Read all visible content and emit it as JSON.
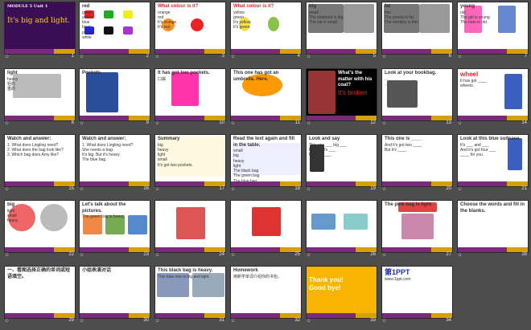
{
  "colors": {
    "background": "#4d4d4d",
    "band_default": "#7a2a7a",
    "band_accent": "#d6a000",
    "red_text": "#d11",
    "blue_text": "#1d2fb0"
  },
  "slides": [
    {
      "num": "1",
      "lines": [
        "MODULE 5  Unit 1",
        "It's big and light."
      ],
      "theme": "purple"
    },
    {
      "num": "2",
      "lines": [
        "red",
        "green",
        "yellow",
        "blue",
        "black",
        "purple",
        "white"
      ],
      "theme": "colors"
    },
    {
      "num": "3",
      "lines": [
        "What colour is it?",
        "orange",
        "red",
        "It's orange.",
        "It's red."
      ],
      "theme": "fruit"
    },
    {
      "num": "4",
      "lines": [
        "What colour is it?",
        "yellow",
        "green",
        "It's yellow.",
        "It's green."
      ],
      "theme": "fruit2"
    },
    {
      "num": "5",
      "lines": [
        "big",
        "small",
        "The elephant is big.",
        "The cat is small."
      ],
      "theme": "photo"
    },
    {
      "num": "6",
      "lines": [
        "fat",
        "thin",
        "The panda is fat.",
        "The monkey is thin."
      ],
      "theme": "photo"
    },
    {
      "num": "7",
      "lines": [
        "young",
        "old",
        "The girl is young.",
        "The man is old."
      ],
      "theme": "cartoon"
    },
    {
      "num": "8",
      "lines": [
        "light",
        "heavy",
        "轻的",
        "重的"
      ],
      "theme": "scale"
    },
    {
      "num": "9",
      "lines": [
        "Pockets"
      ],
      "theme": "coat"
    },
    {
      "num": "10",
      "lines": [
        "It has got two pockets.",
        "口袋"
      ],
      "theme": "bag"
    },
    {
      "num": "11",
      "lines": [
        "This one has got an umbrella. Here."
      ],
      "theme": "umbrella"
    },
    {
      "num": "12",
      "lines": [
        "What's the matter with his coat?",
        "It's broken"
      ],
      "theme": "broken"
    },
    {
      "num": "13",
      "lines": [
        "Look at your bookbag.",
        "...",
        "..."
      ],
      "theme": "bookbag"
    },
    {
      "num": "14",
      "lines": [
        "wheel",
        "It has got ____",
        "wheels."
      ],
      "theme": "wheel"
    },
    {
      "num": "15",
      "lines": [
        "Watch and answer:",
        "1. What does Lingling need?",
        "2. What does the bag look like?",
        "3. Which bag does Amy like?"
      ],
      "theme": "text"
    },
    {
      "num": "16",
      "lines": [
        "Watch and answer:",
        "1. What does Lingling need?",
        "She needs a bag.",
        "It's big. But it's heavy.",
        "The blue bag."
      ],
      "theme": "text"
    },
    {
      "num": "17",
      "lines": [
        "Summary",
        "big",
        "heavy",
        "light",
        "small",
        "It's got two pockets."
      ],
      "theme": "summary"
    },
    {
      "num": "18",
      "lines": [
        "Read the text again and fill in the table.",
        "small",
        "big",
        "heavy",
        "light",
        "The black bag",
        "The green bag",
        "The blue bag"
      ],
      "theme": "table"
    },
    {
      "num": "19",
      "lines": [
        "Look and say",
        "This one ___ big ___",
        "It's ___ it's ___",
        "Bu... It's ___"
      ],
      "theme": "lookandsay"
    },
    {
      "num": "20",
      "lines": [
        "This one is ____",
        "And it's got two ____",
        "But it's ____"
      ],
      "theme": "case"
    },
    {
      "num": "21",
      "lines": [
        "Look at this blue suitcase.",
        "It's ___ and ___",
        "And it's got four ___",
        "____ for you."
      ],
      "theme": "case2"
    },
    {
      "num": "22",
      "lines": [
        "big",
        "light",
        "small",
        "heavy"
      ],
      "theme": "hearts"
    },
    {
      "num": "23",
      "lines": [
        "Let's talk about the pictures.",
        "The green bag is heavy."
      ],
      "theme": "pics"
    },
    {
      "num": "24",
      "lines": [],
      "theme": "photo2"
    },
    {
      "num": "25",
      "lines": [],
      "theme": "kite"
    },
    {
      "num": "26",
      "lines": [],
      "theme": "shoes"
    },
    {
      "num": "27",
      "lines": [
        "The pink bag is light."
      ],
      "theme": "pinkbag"
    },
    {
      "num": "28",
      "lines": [
        "Choose the words and fill in the blanks."
      ],
      "theme": "fill"
    },
    {
      "num": "29",
      "lines": [
        "一、看图选择正确的单词或短语填空。"
      ],
      "theme": "exercise"
    },
    {
      "num": "30",
      "lines": [
        "小组表演对话"
      ],
      "theme": "group"
    },
    {
      "num": "31",
      "lines": [
        "This black bag is heavy.",
        "This blue one is big and light."
      ],
      "theme": "photos3"
    },
    {
      "num": "32",
      "lines": [
        "Homework",
        "用新学单词介绍你的书包。"
      ],
      "theme": "homework"
    },
    {
      "num": "33",
      "lines": [
        "Thank you!",
        "Good bye!"
      ],
      "theme": "thanks"
    },
    {
      "num": "34",
      "lines": [
        "第1PPT",
        "www.1ppt.com"
      ],
      "theme": "ppt"
    }
  ]
}
